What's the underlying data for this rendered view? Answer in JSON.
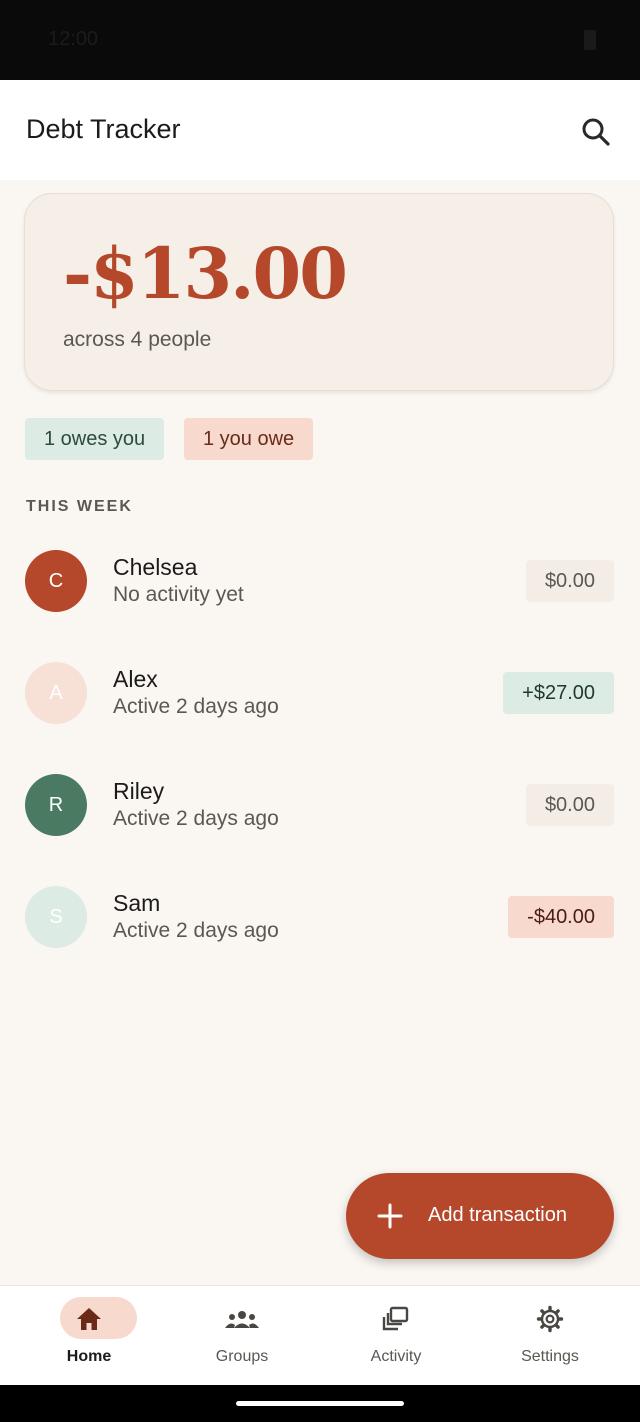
{
  "status_bar": {
    "time": "12:00"
  },
  "app_bar": {
    "title": "Debt Tracker"
  },
  "summary": {
    "amount": "-$13.00",
    "subtitle": "across 4 people"
  },
  "chips": {
    "owes_you": "1 owes you",
    "you_owe": "1 you owe"
  },
  "section": {
    "label": "THIS WEEK"
  },
  "people": [
    {
      "initial": "C",
      "name": "Chelsea",
      "status": "No activity yet",
      "amount": "$0.00",
      "avatar_color": "#b5482a",
      "avatar_text_color": "#ffffff",
      "amount_kind": "neutral"
    },
    {
      "initial": "A",
      "name": "Alex",
      "status": "Active 2 days ago",
      "amount": "+$27.00",
      "avatar_color": "#f7e0d6",
      "avatar_text_color": "#ffffff",
      "amount_kind": "positive"
    },
    {
      "initial": "R",
      "name": "Riley",
      "status": "Active 2 days ago",
      "amount": "$0.00",
      "avatar_color": "#4a7a62",
      "avatar_text_color": "#ffffff",
      "amount_kind": "neutral"
    },
    {
      "initial": "S",
      "name": "Sam",
      "status": "Active 2 days ago",
      "amount": "-$40.00",
      "avatar_color": "#dcebe3",
      "avatar_text_color": "#ffffff",
      "amount_kind": "negative"
    }
  ],
  "fab": {
    "label": "Add transaction",
    "icon": "plus-icon"
  },
  "nav": {
    "items": [
      {
        "label": "Home",
        "icon": "home-icon",
        "active": true
      },
      {
        "label": "Groups",
        "icon": "groups-icon",
        "active": false
      },
      {
        "label": "Activity",
        "icon": "activity-icon",
        "active": false
      },
      {
        "label": "Settings",
        "icon": "gear-icon",
        "active": false
      }
    ]
  },
  "colors": {
    "accent": "#b5482a",
    "background": "#faf7f3",
    "positive": "#dcebe3",
    "negative": "#f7d9cd"
  }
}
